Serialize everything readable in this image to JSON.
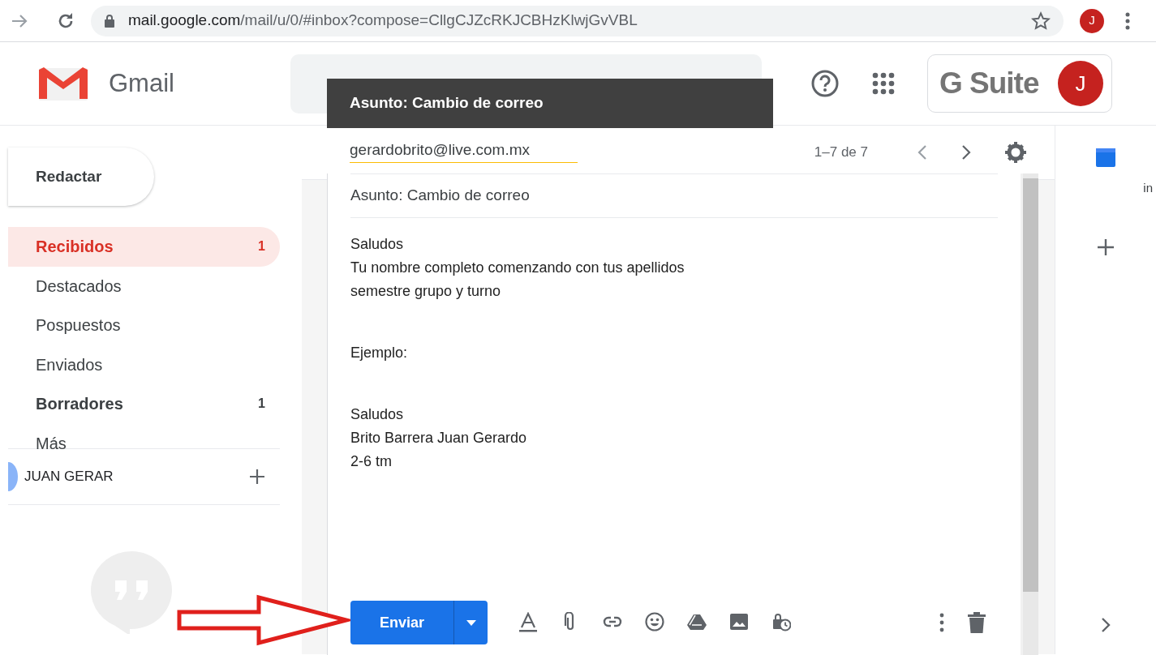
{
  "browser": {
    "url_host": "mail.google.com",
    "url_path": "/mail/u/0/#inbox?compose=CllgCJZcRKJCBHzKlwjGvVBL",
    "avatar": "J"
  },
  "header": {
    "app_name": "Gmail",
    "brand": "G Suite",
    "avatar": "J"
  },
  "sidebar": {
    "compose": "Redactar",
    "items": [
      {
        "label": "Recibidos",
        "count": "1",
        "selected": true,
        "unread": true
      },
      {
        "label": "Destacados",
        "selected": false,
        "unread": false
      },
      {
        "label": "Pospuestos",
        "selected": false,
        "unread": false
      },
      {
        "label": "Enviados",
        "selected": false,
        "unread": false
      },
      {
        "label": "Borradores",
        "count": "1",
        "selected": false,
        "unread": true
      },
      {
        "label": "Más",
        "selected": false,
        "unread": false
      }
    ],
    "hangouts_user": "JUAN GERAR"
  },
  "list": {
    "pagination": "1–7 de 7"
  },
  "compose": {
    "title": "Asunto: Cambio de correo",
    "to": "gerardobrito@live.com.mx",
    "subject": "Asunto: Cambio de correo",
    "body": [
      {
        "lines": [
          "Saludos",
          "Tu nombre completo comenzando con tus apellidos",
          "semestre grupo y turno"
        ]
      },
      {
        "lines": [
          "Ejemplo:"
        ]
      },
      {
        "lines": [
          "Saludos",
          "Brito Barrera Juan Gerardo",
          "2-6 tm"
        ]
      }
    ],
    "send": "Enviar"
  },
  "side_panel": {
    "text": "in"
  }
}
